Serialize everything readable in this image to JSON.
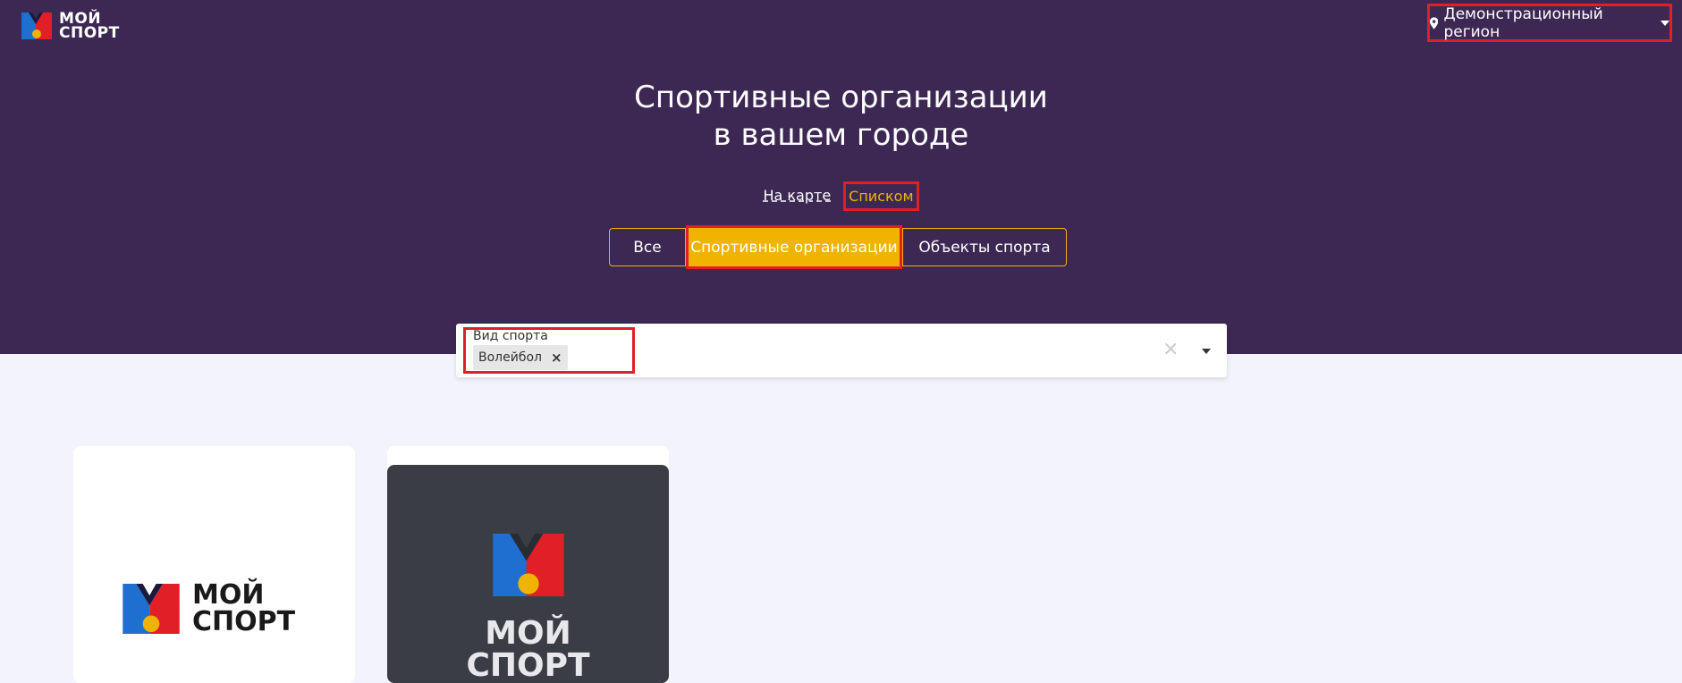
{
  "header": {
    "logo_line1": "МОЙ",
    "logo_line2": "СПОРТ",
    "region_label": "Демонстрационный регион"
  },
  "hero": {
    "title_line1": "Спортивные организации",
    "title_line2": "в вашем городе"
  },
  "view_toggle": {
    "map_label": "На карте",
    "list_label": "Списком"
  },
  "filters": {
    "all_label": "Все",
    "orgs_label": "Спортивные организации",
    "objects_label": "Объекты спорта"
  },
  "sport_select": {
    "label": "Вид спорта",
    "selected": "Волейбол"
  },
  "cards": [
    {
      "logo_line1": "МОЙ",
      "logo_line2": "СПОРТ"
    },
    {
      "logo_line1": "МОЙ",
      "logo_line2": "СПОРТ"
    }
  ],
  "colors": {
    "hero_bg": "#3d2854",
    "accent": "#f0b400",
    "highlight": "#e01f26"
  }
}
